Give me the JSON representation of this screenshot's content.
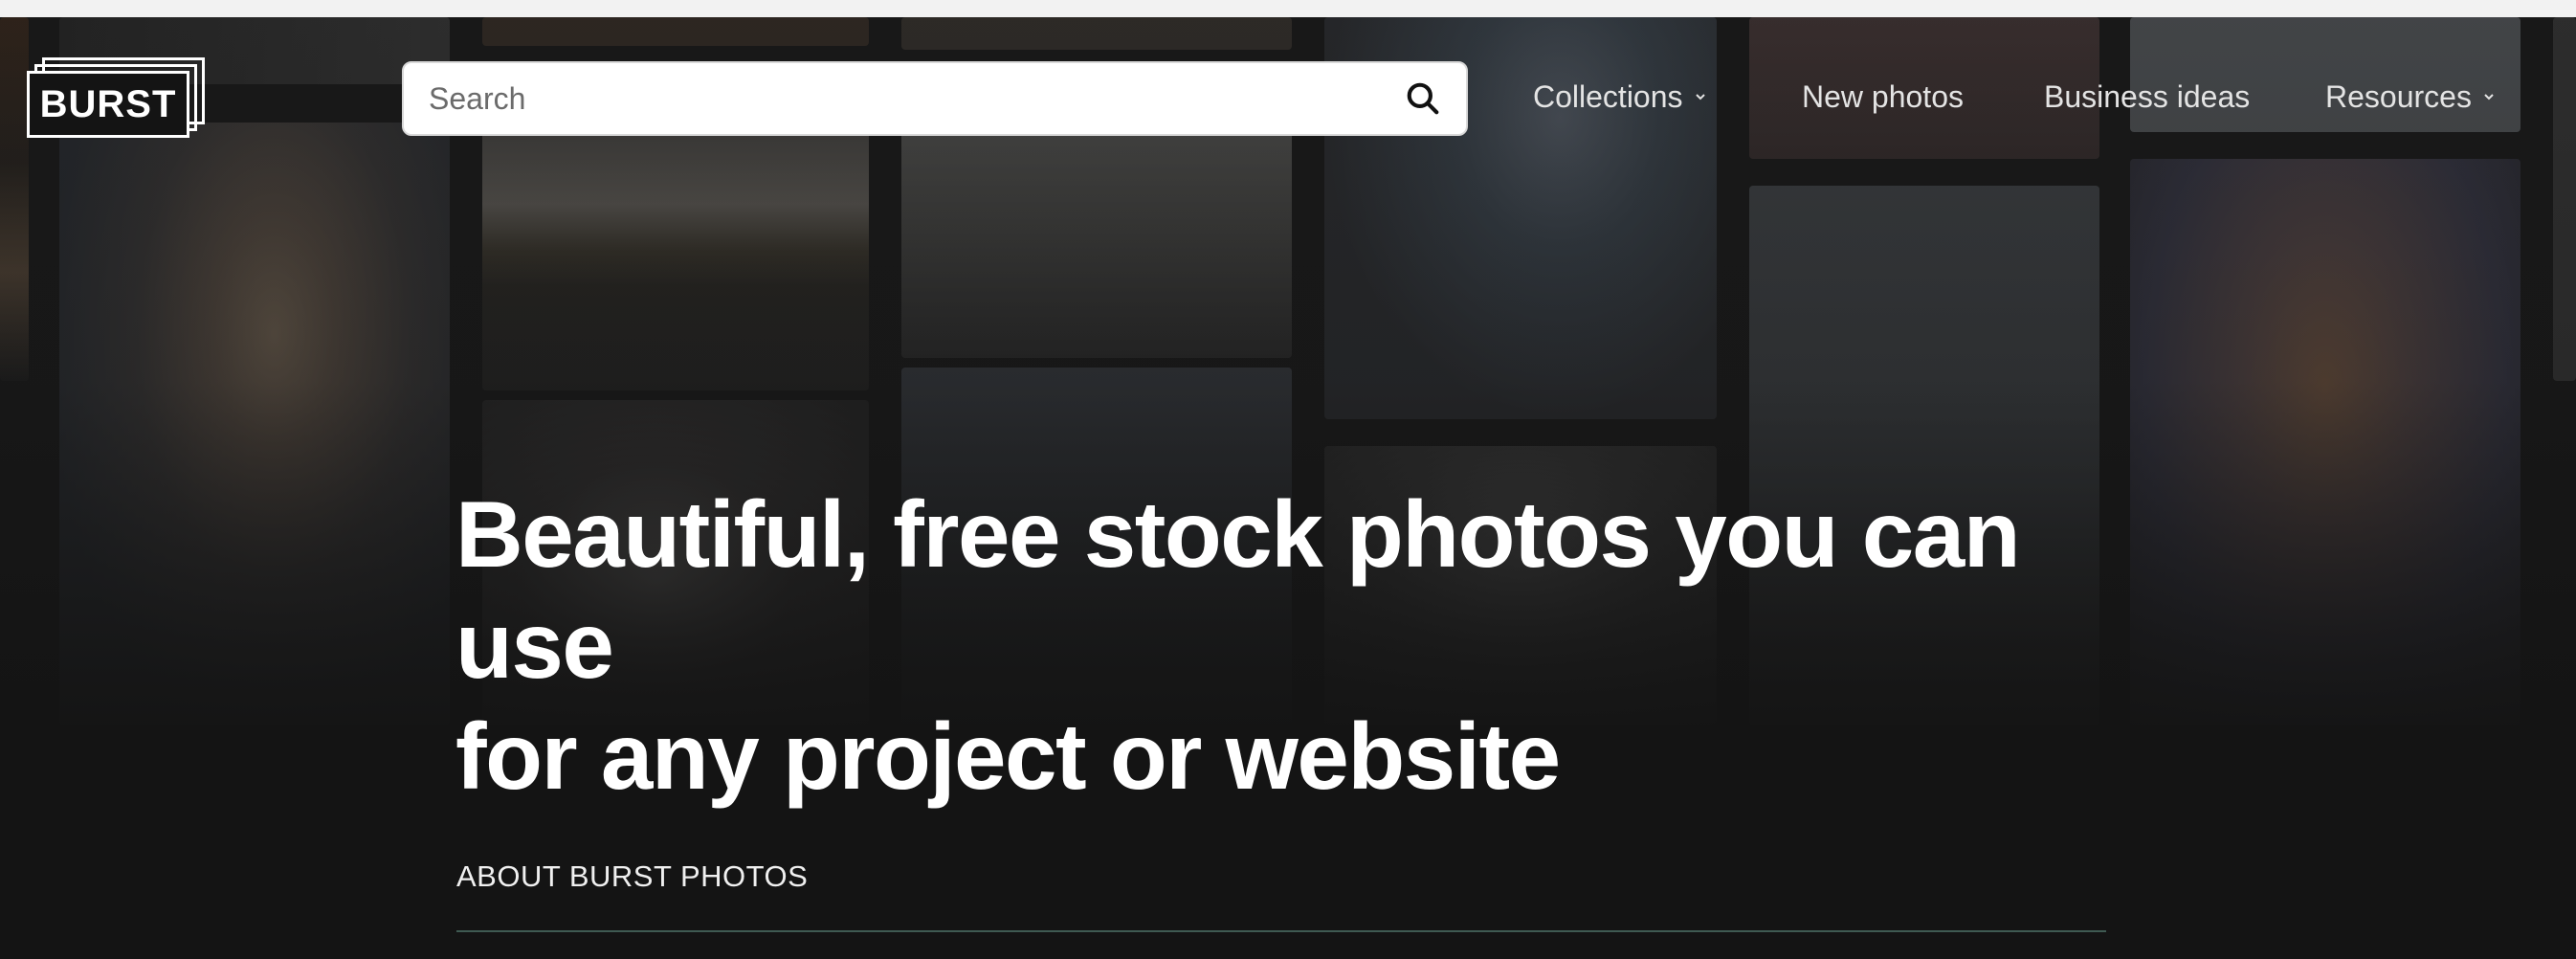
{
  "logo": {
    "text": "BURST"
  },
  "search": {
    "placeholder": "Search",
    "icon": "search-icon"
  },
  "nav": {
    "items": [
      {
        "label": "Collections",
        "has_dropdown": true
      },
      {
        "label": "New photos",
        "has_dropdown": false
      },
      {
        "label": "Business ideas",
        "has_dropdown": false
      },
      {
        "label": "Resources",
        "has_dropdown": true
      }
    ]
  },
  "hero": {
    "headline_line1": "Beautiful, free stock photos you can use",
    "headline_line2": "for any project or website"
  },
  "about": {
    "heading": "ABOUT BURST PHOTOS"
  },
  "colors": {
    "background": "#141414",
    "text": "#ffffff",
    "nav_text": "#e4e4e4",
    "divider": "#3f5a52"
  }
}
